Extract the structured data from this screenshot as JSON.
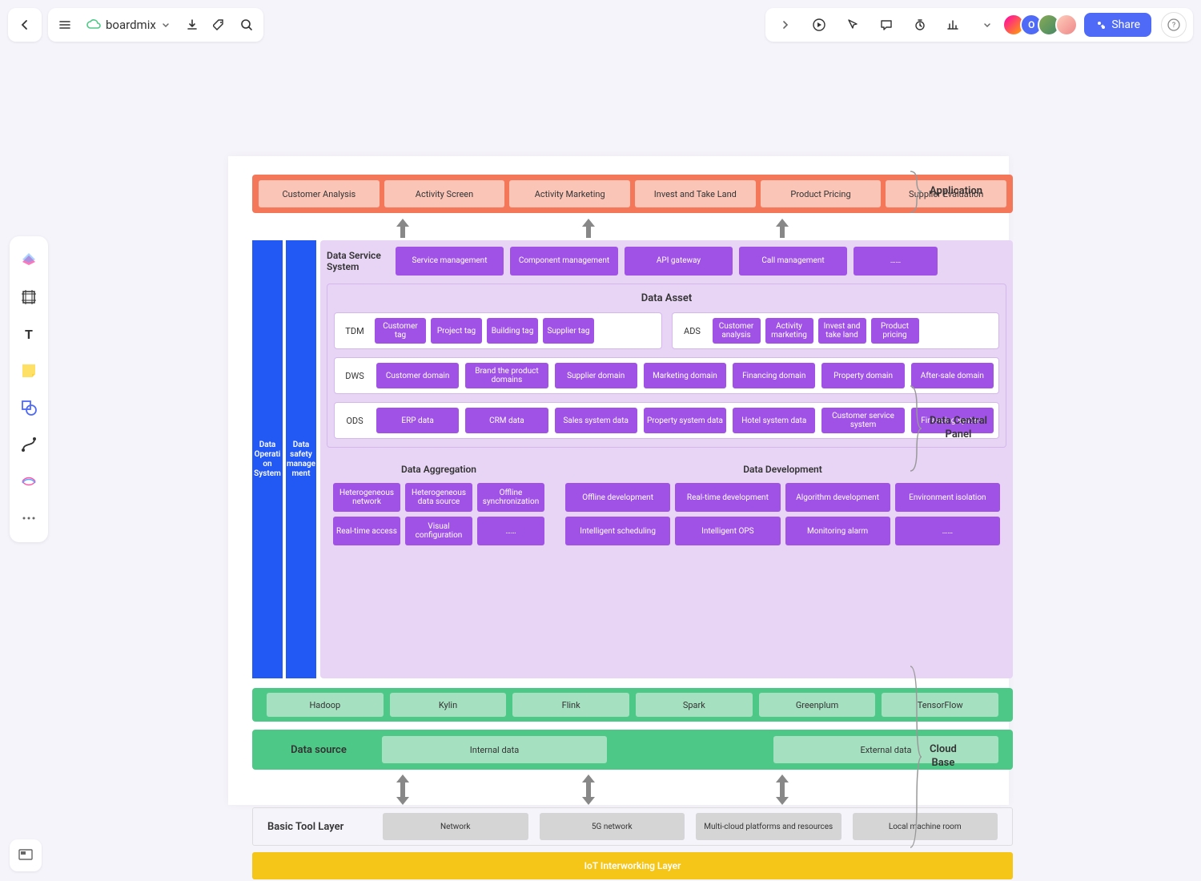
{
  "app_title": "boardmix",
  "share_label": "Share",
  "side_labels": {
    "application": "Application",
    "data_central": "Data Central\nPanel",
    "cloud_base": "Cloud\nBase"
  },
  "application": [
    "Customer Analysis",
    "Activity Screen",
    "Activity Marketing",
    "Invest and Take Land",
    "Product Pricing",
    "Supplier Evaluation"
  ],
  "blue_sides": [
    "Data Operati on System",
    "Data safety manage ment"
  ],
  "dss": {
    "title": "Data Service System",
    "items": [
      "Service management",
      "Component management",
      "API gateway",
      "Call management",
      "……"
    ]
  },
  "data_asset": {
    "title": "Data Asset",
    "tdm": {
      "label": "TDM",
      "items": [
        "Customer tag",
        "Project tag",
        "Building tag",
        "Supplier tag"
      ]
    },
    "ads": {
      "label": "ADS",
      "items": [
        "Customer analysis",
        "Activity marketing",
        "Invest and take land",
        "Product pricing"
      ]
    },
    "dws": {
      "label": "DWS",
      "items": [
        "Customer domain",
        "Brand the product domains",
        "Supplier domain",
        "Marketing domain",
        "Financing domain",
        "Property domain",
        "After-sale domain"
      ]
    },
    "ods": {
      "label": "ODS",
      "items": [
        "ERP data",
        "CRM data",
        "Sales system data",
        "Property system data",
        "Hotel system data",
        "Customer service system",
        "Financing system"
      ]
    }
  },
  "aggregation": {
    "title": "Data Aggregation",
    "items": [
      "Heterogeneous network",
      "Heterogeneous data source",
      "Offline synchronization",
      "Real-time access",
      "Visual configuration",
      "……"
    ]
  },
  "development": {
    "title": "Data Development",
    "items": [
      "Offline development",
      "Real-time development",
      "Algorithm development",
      "Environment isolation",
      "Intelligent scheduling",
      "Intelligent OPS",
      "Monitoring alarm",
      "……"
    ]
  },
  "compute": [
    "Hadoop",
    "Kylin",
    "Flink",
    "Spark",
    "Greenplum",
    "TensorFlow"
  ],
  "data_source": {
    "label": "Data source",
    "internal": "Internal data",
    "external": "External data"
  },
  "tool_layer": {
    "label": "Basic Tool Layer",
    "items": [
      "Network",
      "5G network",
      "Multi-cloud platforms and resources",
      "Local machine room"
    ]
  },
  "iot_layer": "IoT Interworking Layer"
}
